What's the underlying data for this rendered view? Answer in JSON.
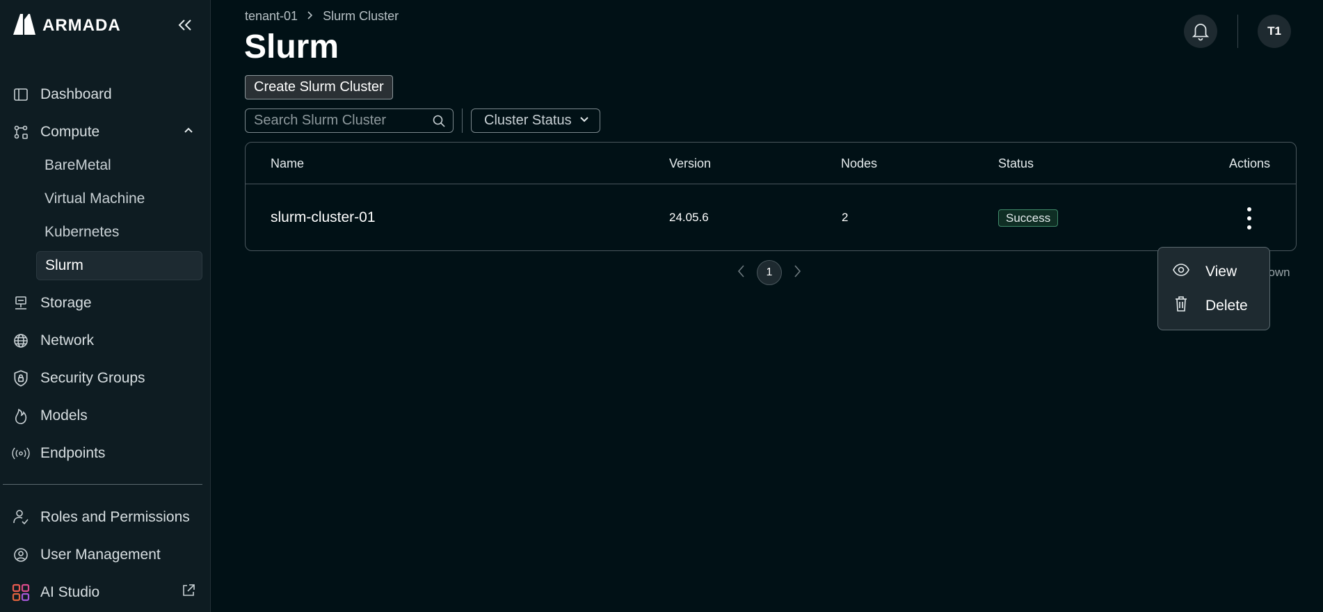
{
  "brand": {
    "name": "ARMADA"
  },
  "sidebar": {
    "items": [
      {
        "label": "Dashboard",
        "icon": "dashboard-icon"
      },
      {
        "label": "Compute",
        "icon": "compute-icon",
        "expanded": true,
        "children": [
          {
            "label": "BareMetal"
          },
          {
            "label": "Virtual Machine"
          },
          {
            "label": "Kubernetes"
          },
          {
            "label": "Slurm",
            "active": true
          }
        ]
      },
      {
        "label": "Storage",
        "icon": "storage-icon"
      },
      {
        "label": "Network",
        "icon": "globe-icon"
      },
      {
        "label": "Security Groups",
        "icon": "shield-lock-icon"
      },
      {
        "label": "Models",
        "icon": "flame-icon"
      },
      {
        "label": "Endpoints",
        "icon": "broadcast-icon"
      }
    ],
    "bottom_items": [
      {
        "label": "Roles and Permissions",
        "icon": "users-check-icon"
      },
      {
        "label": "User Management",
        "icon": "user-circle-icon"
      },
      {
        "label": "AI Studio",
        "icon": "ai-studio-icon",
        "external": true
      }
    ]
  },
  "breadcrumb": {
    "root": "tenant-01",
    "current": "Slurm Cluster"
  },
  "page": {
    "title": "Slurm"
  },
  "toolbar": {
    "create_label": "Create Slurm Cluster",
    "search_placeholder": "Search Slurm Cluster",
    "filter_label": "Cluster Status"
  },
  "header": {
    "avatar_initials": "T1"
  },
  "table": {
    "columns": [
      "Name",
      "Version",
      "Nodes",
      "Status",
      "Actions"
    ],
    "rows": [
      {
        "name": "slurm-cluster-01",
        "version": "24.05.6",
        "nodes": "2",
        "status": "Success"
      }
    ]
  },
  "pagination": {
    "current_page": "1",
    "shown_text": "hown"
  },
  "context_menu": {
    "items": [
      {
        "label": "View",
        "icon": "eye-icon"
      },
      {
        "label": "Delete",
        "icon": "trash-icon"
      }
    ]
  },
  "colors": {
    "background": "#011116",
    "sidebar": "#0e1c22",
    "success_border": "#3f8a6a"
  }
}
